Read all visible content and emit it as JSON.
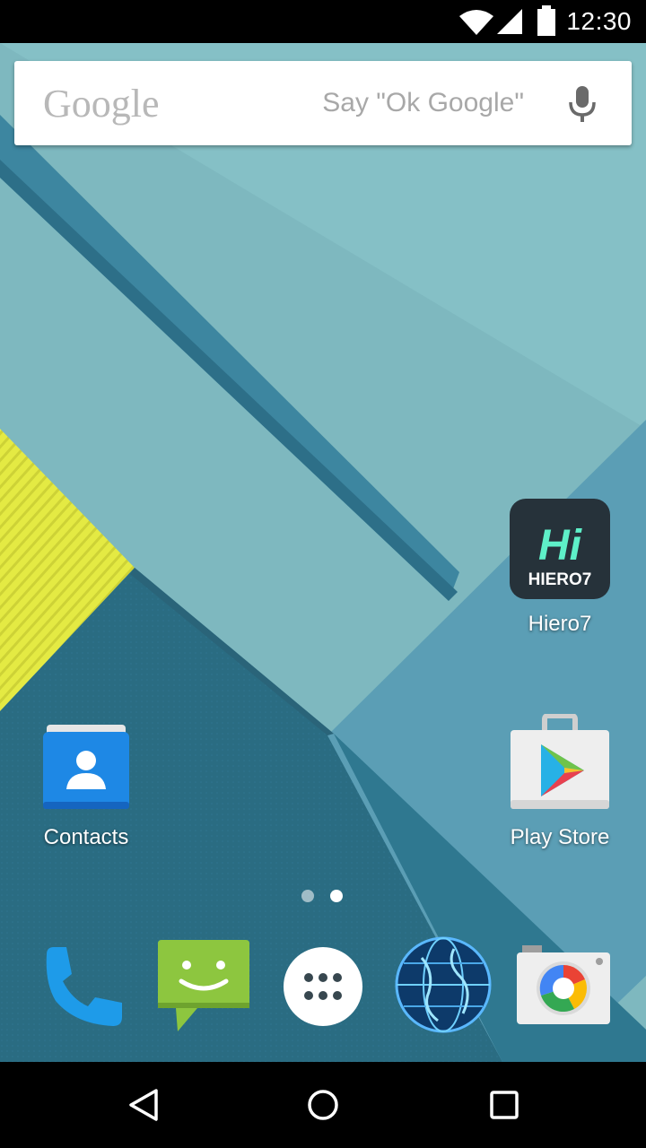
{
  "status_bar": {
    "time": "12:30",
    "icons": [
      "wifi-icon",
      "cellular-signal-icon",
      "battery-icon"
    ]
  },
  "search": {
    "logo": "Google",
    "hint": "Say \"Ok Google\"",
    "icon": "mic-icon"
  },
  "apps": {
    "hiero7": {
      "label": "Hiero7",
      "icon_text": "HIERO7",
      "icon_glyph": "Hi"
    },
    "contacts": {
      "label": "Contacts"
    },
    "play_store": {
      "label": "Play Store"
    }
  },
  "page_indicator": {
    "pages": 2,
    "current": 2
  },
  "dock": [
    "phone-icon",
    "messaging-icon",
    "app-drawer-icon",
    "browser-globe-icon",
    "camera-icon"
  ],
  "nav": [
    "back-icon",
    "home-icon",
    "recents-icon"
  ],
  "colors": {
    "wallpaper_light": "#7fb8bf",
    "wallpaper_mid": "#4a98ad",
    "wallpaper_dark": "#2c7187",
    "wallpaper_yellow": "#e2e83f"
  }
}
